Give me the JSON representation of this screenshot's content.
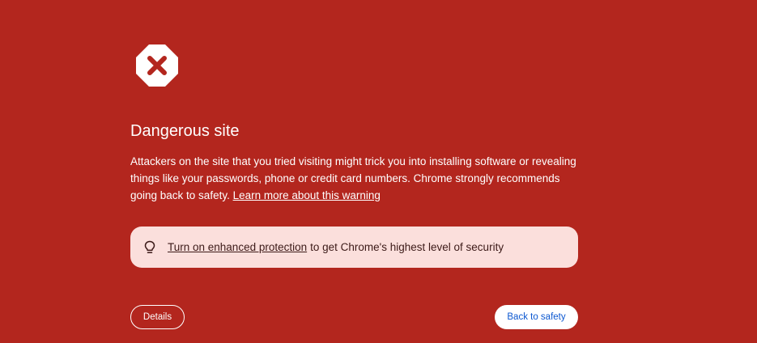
{
  "icons": {
    "warning": "stop-x-icon",
    "promo": "lightbulb-icon"
  },
  "colors": {
    "background": "#b3261e",
    "promo_background": "#fbdfdc",
    "primary_button_text": "#0b57d0"
  },
  "heading": "Dangerous site",
  "description": {
    "text": "Attackers on the site that you tried visiting might trick you into installing software or revealing things like your passwords, phone or credit card numbers. Chrome strongly recommends going back to safety. ",
    "learn_more_link": "Learn more about this warning"
  },
  "promo": {
    "link": "Turn on enhanced protection",
    "text": "to get Chrome's highest level of security"
  },
  "buttons": {
    "details": "Details",
    "back_to_safety": "Back to safety"
  }
}
